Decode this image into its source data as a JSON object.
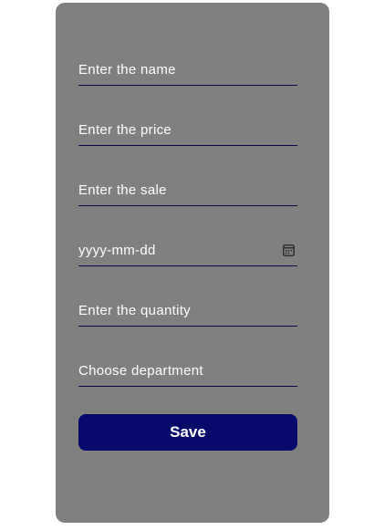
{
  "form": {
    "fields": [
      {
        "placeholder": "Enter the name"
      },
      {
        "placeholder": "Enter the price"
      },
      {
        "placeholder": "Enter the sale"
      },
      {
        "placeholder": "yyyy-mm-dd",
        "icon": "calendar-icon"
      },
      {
        "placeholder": "Enter the quantity"
      },
      {
        "placeholder": "Choose department"
      }
    ],
    "save_label": "Save"
  },
  "colors": {
    "card": "#808080",
    "button": "#050a6a",
    "underline": "#0a0a4a"
  }
}
